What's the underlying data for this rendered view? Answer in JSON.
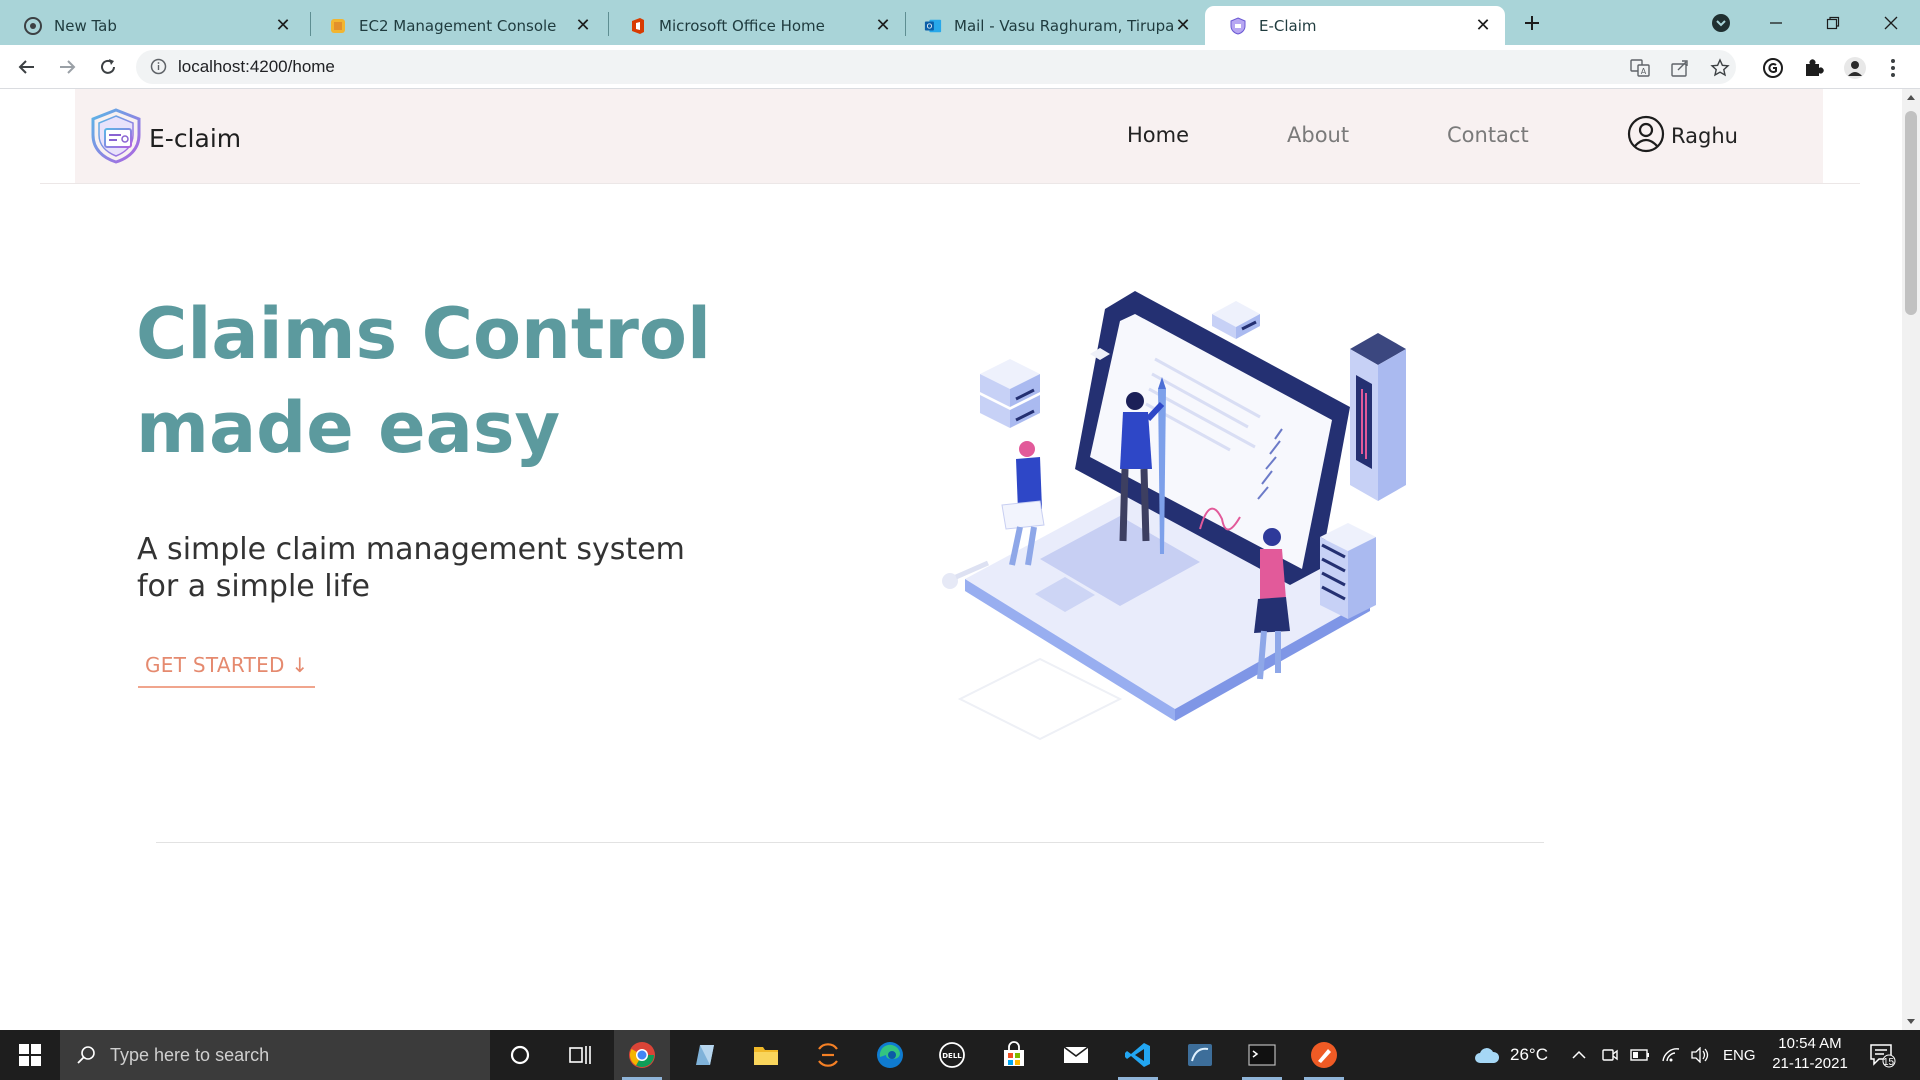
{
  "browser": {
    "tabs": [
      {
        "title": "New Tab",
        "icon": "chrome-icon",
        "active": false
      },
      {
        "title": "EC2 Management Console",
        "icon": "aws-icon",
        "active": false
      },
      {
        "title": "Microsoft Office Home",
        "icon": "office-icon",
        "active": false
      },
      {
        "title": "Mail - Vasu Raghuram, Tirupati (C",
        "icon": "outlook-icon",
        "active": false
      },
      {
        "title": "E-Claim",
        "icon": "eclaim-icon",
        "active": true
      }
    ],
    "address": "localhost:4200/home"
  },
  "page": {
    "brand": "E-claim",
    "nav": [
      "Home",
      "About",
      "Contact"
    ],
    "user": "Raghu",
    "hero_title": [
      "Claims Control",
      "made easy"
    ],
    "hero_subtitle": [
      "A simple claim management system",
      "for a simple life"
    ],
    "cta": "GET STARTED ↓"
  },
  "taskbar": {
    "search_placeholder": "Type here to search",
    "weather": "26°C",
    "language": "ENG",
    "time": "10:54 AM",
    "date": "21-11-2021",
    "notifications": "15"
  },
  "colors": {
    "tabstrip": "#a9d4d8",
    "hero_title": "#5c9a9e",
    "cta": "#e58a6f",
    "navbar_bg": "#f8f1f1",
    "taskbar": "#1e1e1e"
  }
}
